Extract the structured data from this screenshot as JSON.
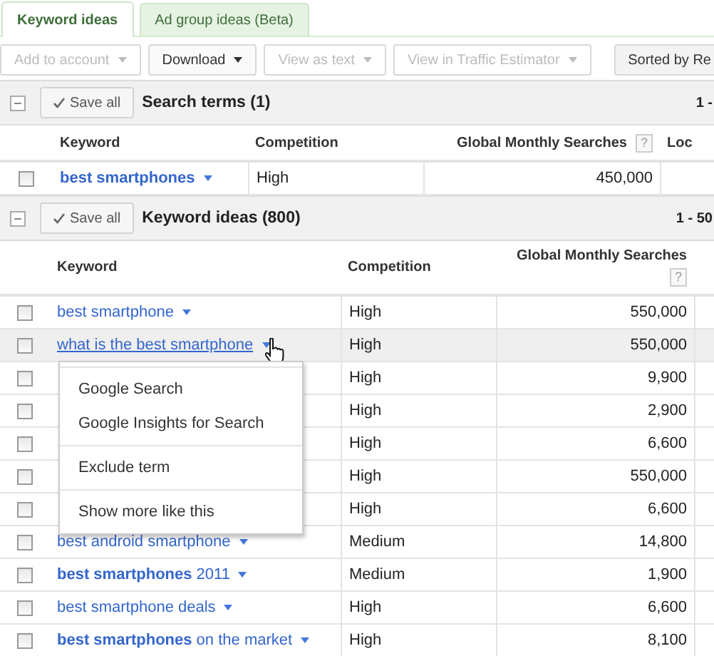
{
  "tabs": [
    {
      "label": "Keyword ideas",
      "selected": true
    },
    {
      "label": "Ad group ideas (Beta)",
      "selected": false
    }
  ],
  "toolbar": [
    {
      "label": "Add to account",
      "disabled": true,
      "dropdown": true
    },
    {
      "label": "Download",
      "disabled": false,
      "dropdown": true
    },
    {
      "label": "View as text",
      "disabled": true,
      "dropdown": true
    },
    {
      "label": "View in Traffic Estimator",
      "disabled": true,
      "dropdown": true
    },
    {
      "label": "Sorted by Re",
      "disabled": false,
      "dropdown": false
    }
  ],
  "sections": [
    {
      "kind": "search_terms",
      "save_label": "Save all",
      "title": "Search terms (1)",
      "range": "1 -",
      "expanded": true,
      "columns": [
        {
          "label": "Keyword"
        },
        {
          "label": "Competition"
        },
        {
          "label": "Global Monthly Searches",
          "help": "?"
        },
        {
          "label": "Loc"
        }
      ],
      "rows": [
        {
          "checked": false,
          "hovered": false,
          "bold": true,
          "keyword": "best smartphones",
          "competition": "High",
          "searches": "450,000"
        }
      ]
    },
    {
      "kind": "keyword_ideas",
      "save_label": "Save all",
      "title": "Keyword ideas (800)",
      "range": "1 - 50",
      "expanded": true,
      "columns": [
        {
          "label": "Keyword"
        },
        {
          "label": "Competition"
        },
        {
          "label": "Global Monthly Searches",
          "help": "?"
        }
      ],
      "rows": [
        {
          "checked": false,
          "hovered": false,
          "bold": false,
          "keyword": "best smartphone",
          "competition": "High",
          "searches": "550,000"
        },
        {
          "checked": false,
          "hovered": true,
          "bold": false,
          "keyword": "what is the best smartphone",
          "competition": "High",
          "searches": "550,000"
        },
        {
          "checked": false,
          "hovered": false,
          "competition": "High",
          "searches": "9,900"
        },
        {
          "checked": false,
          "hovered": false,
          "competition": "High",
          "searches": "2,900"
        },
        {
          "checked": false,
          "hovered": false,
          "competition": "High",
          "searches": "6,600"
        },
        {
          "checked": false,
          "hovered": false,
          "competition": "High",
          "searches": "550,000"
        },
        {
          "checked": false,
          "hovered": false,
          "competition": "High",
          "searches": "6,600"
        },
        {
          "checked": false,
          "hovered": false,
          "bold": false,
          "keyword": "best android smartphone",
          "competition": "Medium",
          "searches": "14,800"
        },
        {
          "checked": false,
          "hovered": false,
          "bold": false,
          "keyword": "**best smartphones** 2011",
          "competition": "Medium",
          "searches": "1,900"
        },
        {
          "checked": false,
          "hovered": false,
          "bold": false,
          "keyword": "best smartphone deals",
          "competition": "High",
          "searches": "6,600"
        },
        {
          "checked": false,
          "hovered": false,
          "bold": false,
          "keyword": "**best smartphones** on the market",
          "competition": "High",
          "searches": "8,100"
        }
      ]
    }
  ],
  "menu": {
    "groups": [
      [
        "Google Search",
        "Google Insights for Search"
      ],
      [
        "Exclude term"
      ],
      [
        "Show more like this"
      ]
    ]
  }
}
